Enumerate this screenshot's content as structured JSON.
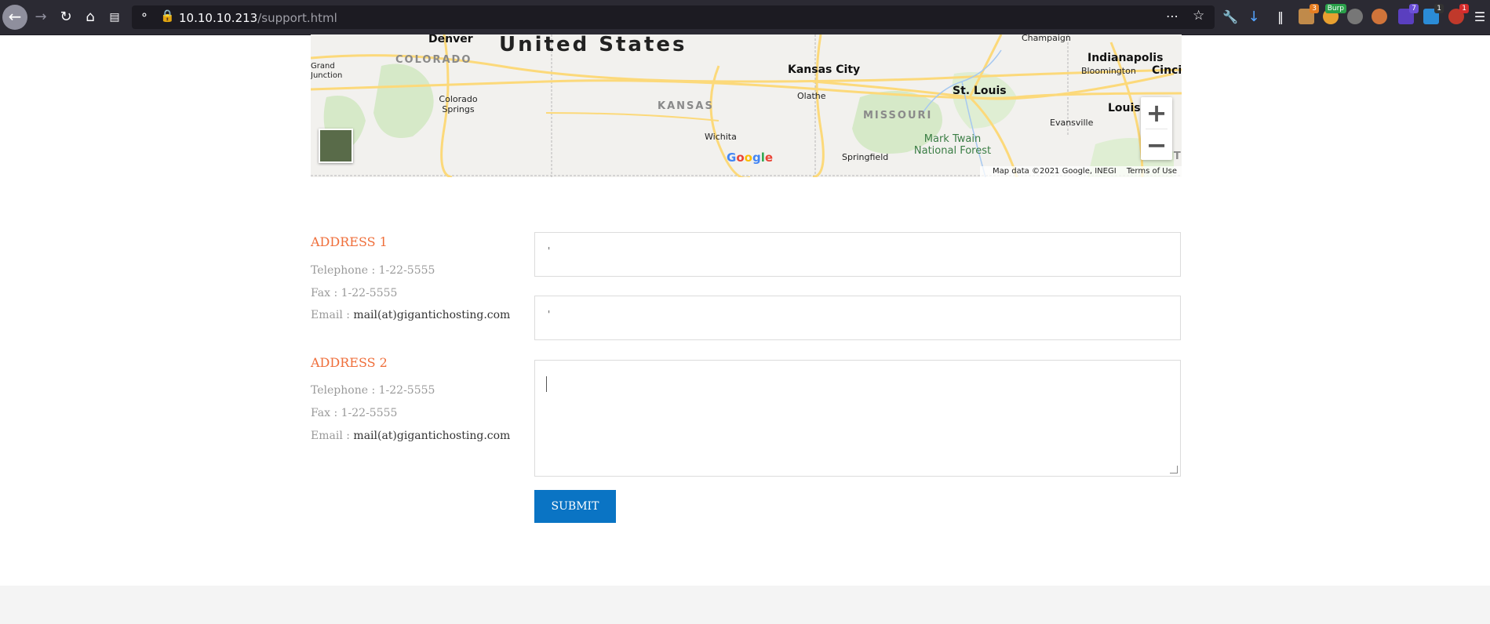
{
  "browser": {
    "url_host": "10.10.10.213",
    "url_path": "/support.html",
    "extension_badges": [
      "3",
      "Burp",
      "7",
      "1",
      "1"
    ]
  },
  "map": {
    "country": "United States",
    "states": [
      "COLORADO",
      "KANSAS",
      "MISSOURI",
      "KENTUCKY"
    ],
    "cities": [
      "Denver",
      "Colorado Springs",
      "Grand Junction",
      "Kansas City",
      "Olathe",
      "Wichita",
      "Springfield",
      "St. Louis",
      "Evansville",
      "Champaign",
      "Indianapolis",
      "Bloomington",
      "Cincinnati",
      "Louisville"
    ],
    "park": "Mark Twain National Forest",
    "attribution": "Map data ©2021 Google, INEGI",
    "terms": "Terms of Use",
    "logo": "Google",
    "zoom_in": "+",
    "zoom_out": "−"
  },
  "addresses": [
    {
      "heading": "ADDRESS 1",
      "telephone": "Telephone : 1-22-5555",
      "fax": "Fax : 1-22-5555",
      "email_label": "Email : ",
      "email": "mail(at)gigantichosting.com"
    },
    {
      "heading": "ADDRESS 2",
      "telephone": "Telephone : 1-22-5555",
      "fax": "Fax : 1-22-5555",
      "email_label": "Email : ",
      "email": "mail(at)gigantichosting.com"
    }
  ],
  "form": {
    "field1_value": "'",
    "field2_value": "'",
    "message_value": "",
    "submit_label": "SUBMIT"
  },
  "colors": {
    "accent_orange": "#ef6e3a",
    "button_blue": "#0a74c4"
  }
}
